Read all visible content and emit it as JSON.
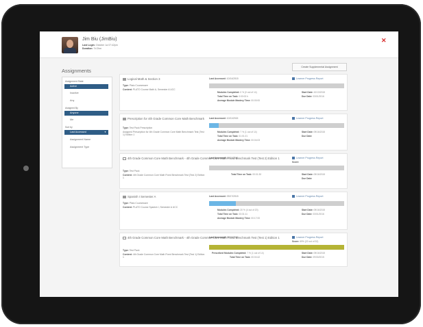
{
  "user": {
    "name": "Jim Biu (JimBiu)",
    "last_login_label": "Last Login:",
    "last_login": "October 1a 07:42pm",
    "duration_label": "Duration:",
    "duration": "7d 2hm"
  },
  "title": "Assignments",
  "create_button": "Create Supplemental Assignment",
  "sidebar": {
    "assignment_state_label": "Assignment State",
    "state_items": [
      "Active",
      "Inactive",
      "Any"
    ],
    "assigned_by_label": "Assigned By",
    "assigned_by_items": [
      "Anyone",
      "Me"
    ],
    "sort_by_label": "Sort by",
    "sort_items": [
      "Last Accessed",
      "Assignment Name",
      "Assignment Type"
    ]
  },
  "cards": [
    {
      "title": "Logical Math & Section 3",
      "type_label": "Type:",
      "type": "Plato Courseware",
      "content_label": "Content:",
      "content": "PLATO Course Math A, Semester A UCC",
      "last_accessed_label": "Last Accessed:",
      "last_accessed": "10/14/2015",
      "report_label": "Learner Progress Report",
      "progress": 0,
      "stats": [
        {
          "label": "Modules Completed:",
          "value": "0 % (0 out of 14)"
        },
        {
          "label": "Total Time on Task:",
          "value": "0:00:00 h"
        },
        {
          "label": "Average Module Mastery Time:",
          "value": "00:00:00"
        }
      ],
      "stats_right": [
        {
          "label": "Start Date:",
          "value": "10/13/2015"
        },
        {
          "label": "Due Date:",
          "value": "03/01/2016"
        }
      ]
    },
    {
      "title": "Prescription for 4th Grade Common Core Math Benchmark",
      "type_label": "Type:",
      "type": "Test Pack Prescription",
      "content": "Assigned Prescription for 4th Grade Common Core Math Benchmark Test (Test 1) Edition 1",
      "last_accessed_label": "Last Accessed:",
      "last_accessed": "10/11/2015",
      "report_label": "Learner Progress Report",
      "progress": 0.07,
      "stats": [
        {
          "label": "Modules Completed:",
          "value": "7 % (1 out of 14)"
        },
        {
          "label": "Total Time on Task:",
          "value": "01:01:21"
        },
        {
          "label": "Average Module Mastery Time:",
          "value": "00:04:03"
        }
      ],
      "stats_right": [
        {
          "label": "Start Date:",
          "value": "09/16/2015"
        },
        {
          "label": "Due Date:",
          "value": ""
        }
      ]
    },
    {
      "title": "4th Grade Common Core Math Benchmark - 4th Grade Common Core Math Fixed Benchmark Test (Test 2) Edition 1",
      "type_label": "Type:",
      "type": "Test Pack",
      "content_label": "Content:",
      "content": "4th Grade Common Core Math Fixed Benchmark Test (Test 2) Edition 1",
      "last_accessed_label": "Last Accessed:",
      "last_accessed": "10/11/2015",
      "report_label": "Learner Progress Report",
      "progress": 0,
      "stats": [
        {
          "label": "Total Time on Task:",
          "value": "00:01:30"
        }
      ],
      "stats_right": [
        {
          "label": "Score:",
          "value": ""
        },
        {
          "label": "Start Date:",
          "value": "09/16/2015"
        },
        {
          "label": "Due Date:",
          "value": ""
        }
      ]
    },
    {
      "title": "Spanish I Semester A",
      "type_label": "Type:",
      "type": "Plato Courseware",
      "content_label": "Content:",
      "content": "PLATO Course Spanish I, Semester A UCC",
      "last_accessed_label": "Last Accessed:",
      "last_accessed": "09/17/2015",
      "report_label": "Learner Progress Report",
      "progress": 0.2,
      "stats": [
        {
          "label": "Modules Completed:",
          "value": "20 % (4 out of 20)"
        },
        {
          "label": "Total Time on Task:",
          "value": "03:31:11"
        },
        {
          "label": "Average Module Mastery Time:",
          "value": "00:17:00"
        }
      ],
      "stats_right": [
        {
          "label": "Start Date:",
          "value": "09/16/2015"
        },
        {
          "label": "Due Date:",
          "value": "03/01/2016"
        }
      ]
    },
    {
      "title": "4th Grade Common Core Math Benchmark - 4th Grade Common Core Math Fixed Benchmark Test (Test 1) Edition 1",
      "type_label": "Type:",
      "type": "Test Pack",
      "content_label": "Content:",
      "content": "4th Grade Common Core Math Fixed Benchmark Test (Test 1) Edition 1",
      "last_accessed_label": "Last Accessed:",
      "last_accessed": "09/16/2015",
      "report_label": "Learner Progress Report",
      "progress": 1,
      "stats": [
        {
          "label": "Prescribed Modules Completed:",
          "value": "7 % (1 out of 14)"
        },
        {
          "label": "Total Time on Task:",
          "value": "00:04:42"
        }
      ],
      "stats_right": [
        {
          "label": "Score:",
          "value": "69% (22 out of 32)"
        },
        {
          "label": "Start Date:",
          "value": "09/16/2015"
        },
        {
          "label": "Due Date:",
          "value": "09/30/2015"
        }
      ]
    }
  ],
  "colors": {
    "accent": "#2f5d86",
    "progress_fill": "#6cb6e5",
    "complete_fill": "#b5b435",
    "close": "#d82d2d",
    "link": "#5a7fa6"
  },
  "icons": {
    "close": "close-icon",
    "report": "bar-chart-icon",
    "assignment": "courseware-icon"
  }
}
